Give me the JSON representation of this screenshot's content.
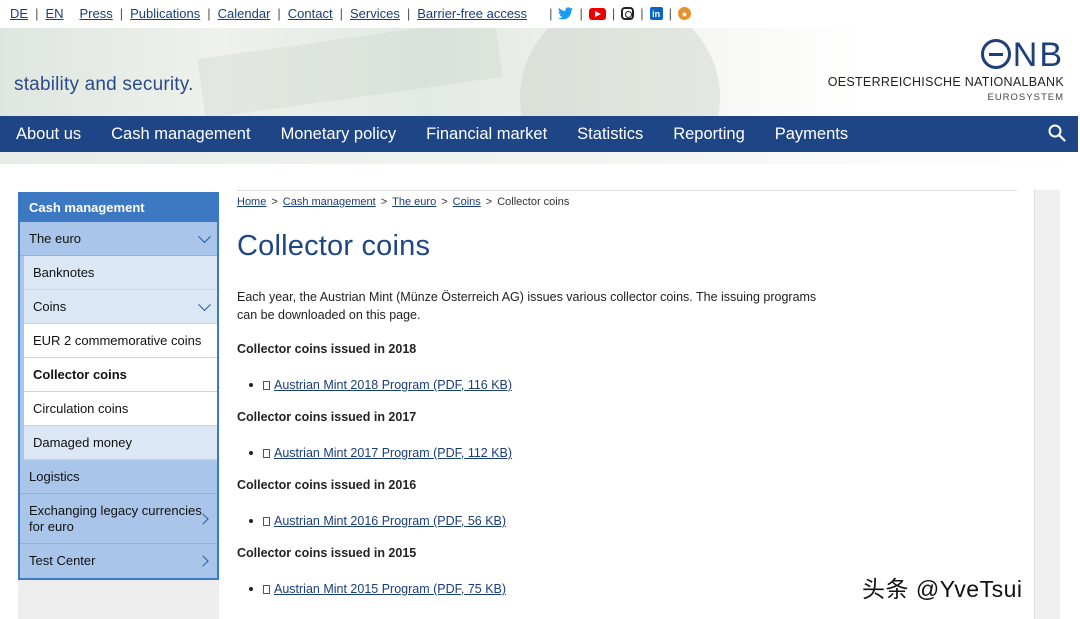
{
  "topbar": {
    "lang_de": "DE",
    "lang_en": "EN",
    "links": [
      "Press",
      "Publications",
      "Calendar",
      "Contact",
      "Services",
      "Barrier-free access"
    ],
    "social_icons": [
      "twitter-icon",
      "youtube-icon",
      "instagram-icon",
      "linkedin-icon",
      "weibo-icon"
    ]
  },
  "banner": {
    "tagline": "stability and security.",
    "logo_mark": "NB",
    "logo_name": "OESTERREICHISCHE NATIONALBANK",
    "logo_sub": "EUROSYSTEM"
  },
  "mainnav": {
    "items": [
      "About us",
      "Cash management",
      "Monetary policy",
      "Financial market",
      "Statistics",
      "Reporting",
      "Payments"
    ]
  },
  "sidebar": {
    "heading": "Cash management",
    "the_euro": "The euro",
    "banknotes": "Banknotes",
    "coins": "Coins",
    "eur2": "EUR 2 commemorative coins",
    "collector": "Collector coins",
    "circulation": "Circulation coins",
    "damaged": "Damaged money",
    "logistics": "Logistics",
    "exchanging": "Exchanging legacy currencies for euro",
    "testcenter": "Test Center"
  },
  "breadcrumb": [
    "Home",
    "Cash management",
    "The euro",
    "Coins",
    "Collector coins"
  ],
  "main": {
    "title": "Collector coins",
    "intro": "Each year, the Austrian Mint (Münze Österreich AG) issues various collector coins. The issuing programs can be downloaded on this page.",
    "sections": [
      {
        "heading": "Collector coins issued in 2018",
        "link": "Austrian Mint 2018 Program (PDF, 116 KB)"
      },
      {
        "heading": "Collector coins issued in 2017",
        "link": "Austrian Mint 2017 Program (PDF, 112 KB)"
      },
      {
        "heading": "Collector coins issued in 2016",
        "link": "Austrian Mint 2016 Program (PDF, 56 KB)"
      },
      {
        "heading": "Collector coins issued in 2015",
        "link": "Austrian Mint 2015 Program (PDF, 75 KB)"
      }
    ]
  },
  "watermark": "头条 @YveTsui",
  "colors": {
    "brand_blue": "#1e4586",
    "sidebar_blue": "#3d79c2",
    "sidebar_light": "#a9c6ea",
    "link": "#1a3e7a"
  }
}
